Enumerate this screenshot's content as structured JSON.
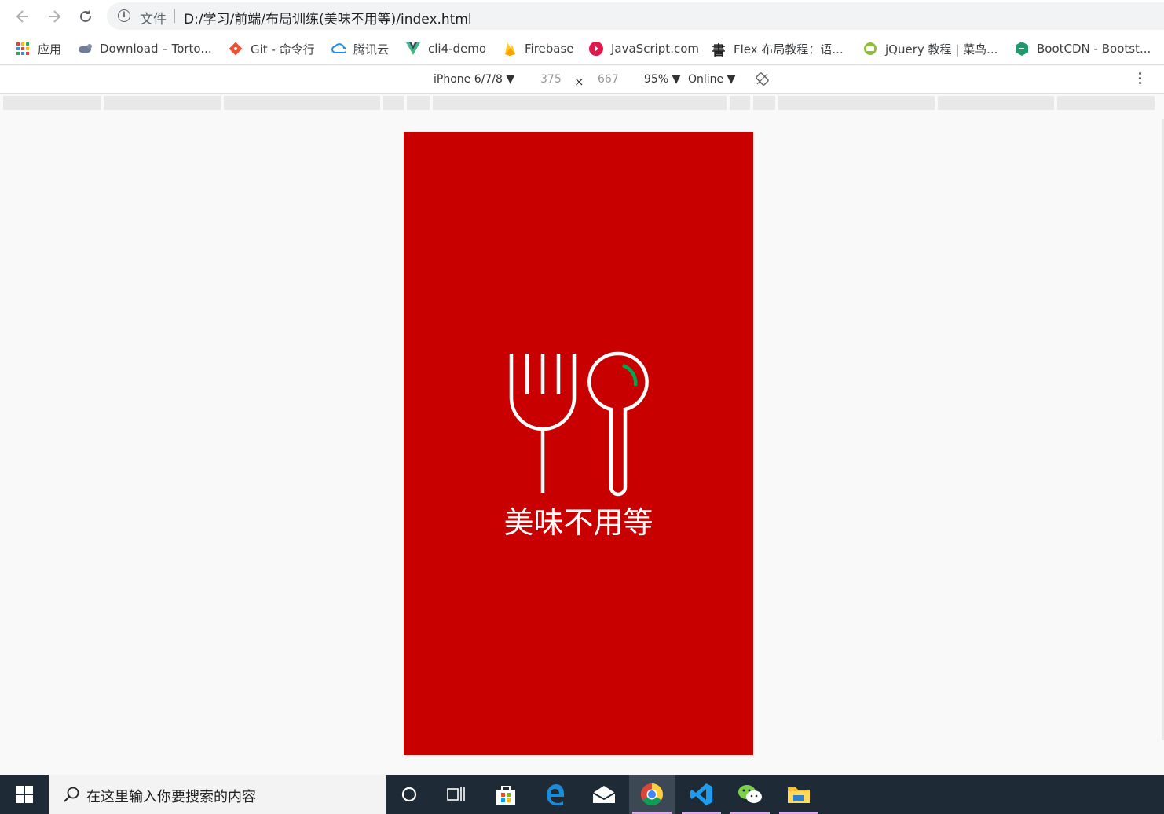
{
  "browser": {
    "omnibox": {
      "file_label": "文件",
      "separator": "|",
      "url": "D:/学习/前端/布局训练(美味不用等)/index.html"
    }
  },
  "bookmarks": [
    {
      "label": "应用",
      "icon": "apps-grid-icon"
    },
    {
      "label": "Download – Torto...",
      "icon": "tortoise-icon"
    },
    {
      "label": "Git - 命令行",
      "icon": "git-icon"
    },
    {
      "label": "腾讯云",
      "icon": "cloud-icon"
    },
    {
      "label": "cli4-demo",
      "icon": "vue-icon"
    },
    {
      "label": "Firebase",
      "icon": "firebase-icon"
    },
    {
      "label": "JavaScript.com",
      "icon": "javascript-icon"
    },
    {
      "label": "Flex 布局教程：语...",
      "icon": "calligraphy-icon"
    },
    {
      "label": "jQuery 教程 | 菜鸟...",
      "icon": "runoob-icon"
    },
    {
      "label": "BootCDN - Bootst...",
      "icon": "bootcdn-icon"
    }
  ],
  "devtools": {
    "device": "iPhone 6/7/8 ▼",
    "width": "375",
    "times": "×",
    "height": "667",
    "zoom": "95% ▼",
    "throttle": "Online ▼"
  },
  "app": {
    "brand": "美味不用等",
    "background": "#c80000",
    "accent": "#00a651"
  },
  "taskbar": {
    "search_placeholder": "在这里输入你要搜索的内容",
    "apps": [
      "cortana-icon",
      "task-view-icon",
      "store-icon",
      "edge-icon",
      "mail-icon",
      "chrome-icon",
      "vscode-icon",
      "wechat-icon",
      "file-explorer-icon"
    ]
  }
}
